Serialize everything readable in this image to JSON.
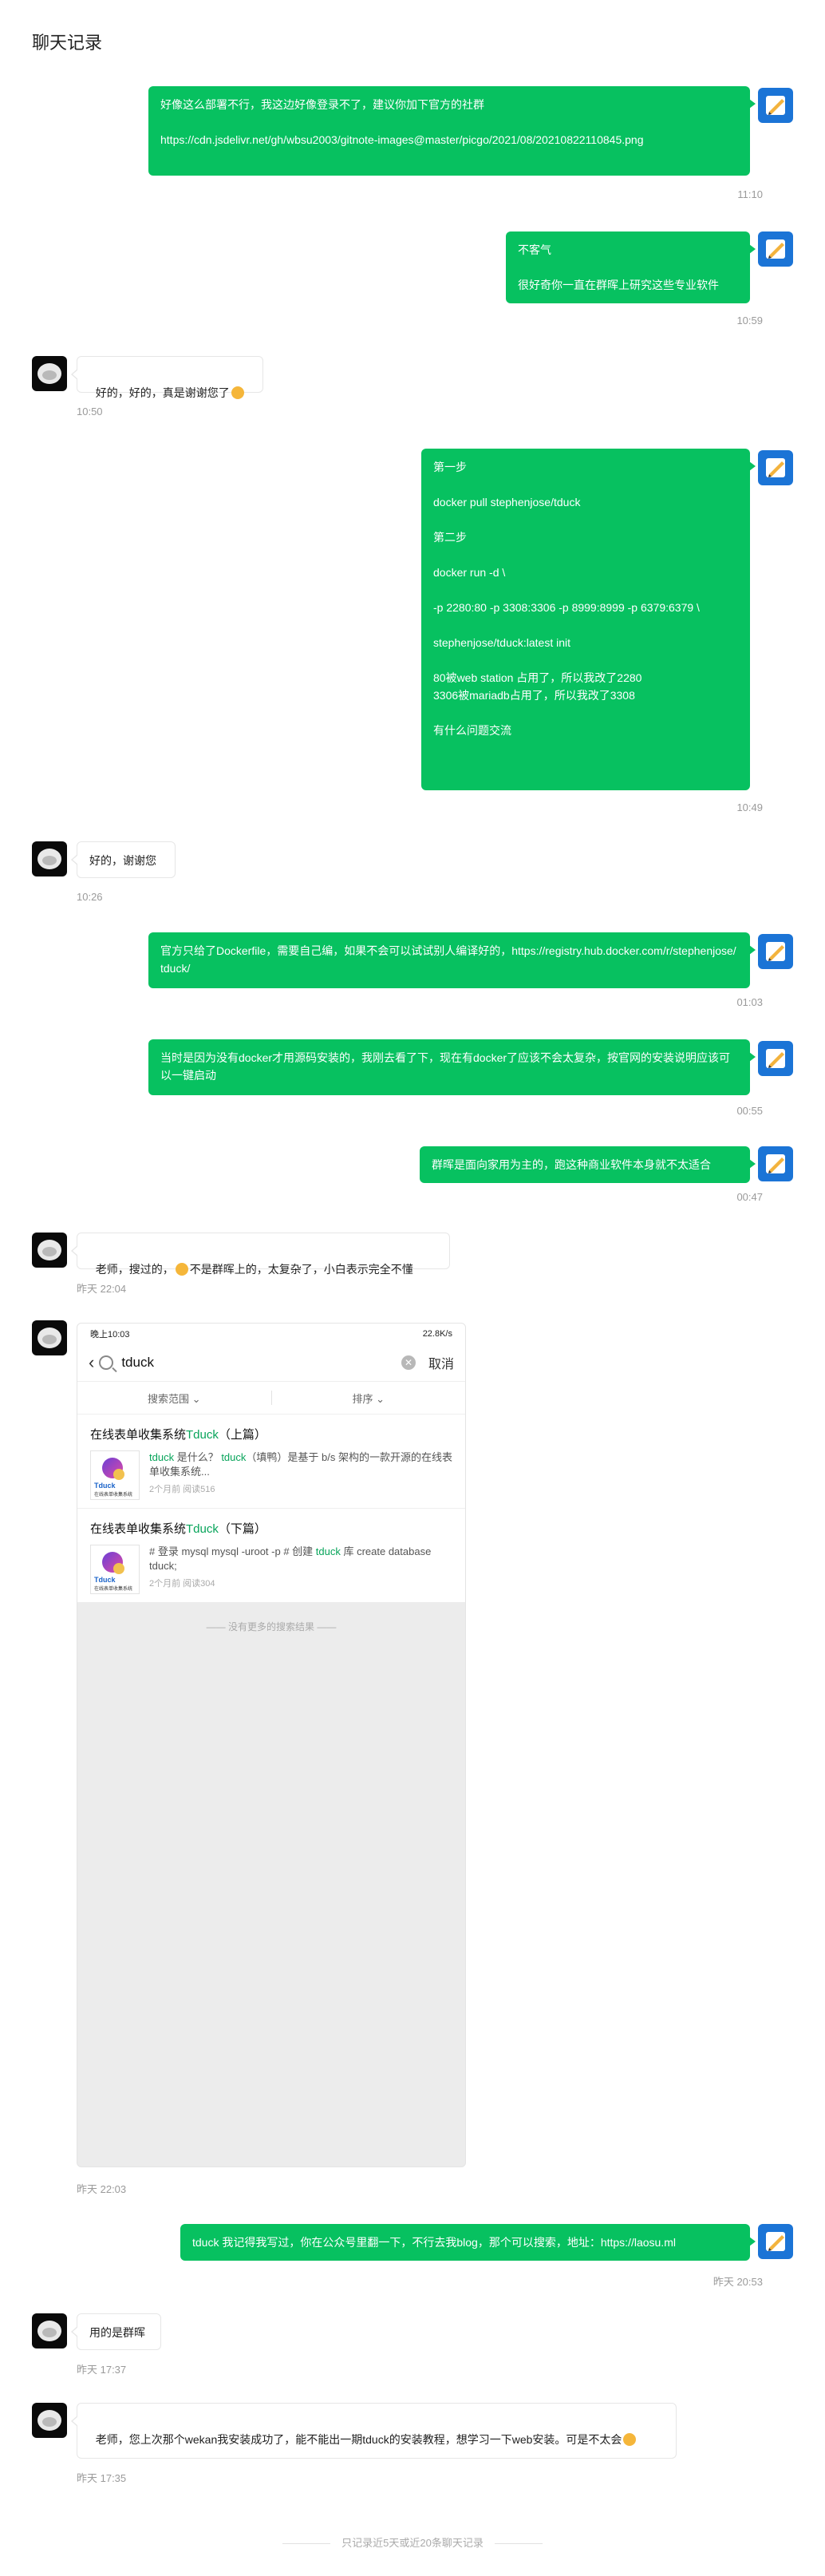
{
  "page": {
    "title": "聊天记录"
  },
  "messages": [
    {
      "side": "right",
      "text": "好像这么部署不行，我这边好像登录不了，建议你加下官方的社群\n\nhttps://cdn.jsdelivr.net/gh/wbsu2003/gitnote-images@master/picgo/2021/08/20210822110845.png",
      "time": "11:10"
    },
    {
      "side": "right",
      "text": "不客气\n\n很好奇你一直在群晖上研究这些专业软件",
      "time": "10:59"
    },
    {
      "side": "left",
      "text": "好的，好的，真是谢谢您了",
      "time": "10:50"
    },
    {
      "side": "right",
      "text": "第一步\n\ndocker pull stephenjose/tduck\n\n第二步\n\ndocker run -d \\\n\n-p 2280:80 -p 3308:3306 -p 8999:8999 -p 6379:6379 \\\n\nstephenjose/tduck:latest init\n\n80被web station 占用了，所以我改了2280\n3306被mariadb占用了，所以我改了3308\n\n有什么问题交流",
      "time": "10:49"
    },
    {
      "side": "left",
      "text": "好的，谢谢您",
      "time": "10:26"
    },
    {
      "side": "right",
      "text": "官方只给了Dockerfile，需要自己编，如果不会可以试试别人编译好的，https://registry.hub.docker.com/r/stephenjose/tduck/",
      "time": "01:03"
    },
    {
      "side": "right",
      "text": "当时是因为没有docker才用源码安装的，我刚去看了下，现在有docker了应该不会太复杂，按官网的安装说明应该可以一键启动",
      "time": "00:55"
    },
    {
      "side": "right",
      "text": "群晖是面向家用为主的，跑这种商业软件本身就不太适合",
      "time": "00:47"
    },
    {
      "side": "left",
      "text_a": "老师，搜过的，",
      "text_b": "不是群晖上的，太复杂了，小白表示完全不懂",
      "time": "昨天 22:04"
    },
    {
      "side": "left",
      "type": "image",
      "time": "昨天 22:03"
    },
    {
      "side": "right",
      "text": "tduck 我记得我写过，你在公众号里翻一下，不行去我blog，那个可以搜索，地址：https://laosu.ml",
      "time": "昨天 20:53"
    },
    {
      "side": "left",
      "text": "用的是群晖",
      "time": "昨天 17:37"
    },
    {
      "side": "left",
      "text_a": "老师，您上次那个wekan我安装成功了，能不能出一期tduck的安装教程，想学习一下web安装。可是不太会",
      "time": "昨天 17:35"
    }
  ],
  "screenshot": {
    "status_left": "晚上10:03",
    "status_right": "22.8K/s",
    "query": "tduck",
    "cancel": "取消",
    "filter1": "搜索范围",
    "filter2": "排序",
    "results": [
      {
        "title_a": "在线表单收集系统",
        "title_hl": "Tduck",
        "title_b": "（上篇）",
        "snippet_hl": "tduck",
        "snippet_a": " 是什么？ ",
        "snippet_hl2": "tduck",
        "snippet_b": "（填鸭）是基于 b/s 架构的一款开源的在线表单收集系统...",
        "meta": "2个月前   阅读516",
        "thumb_brand": "Tduck",
        "thumb_caption": "在线表单收集系统"
      },
      {
        "title_a": "在线表单收集系统",
        "title_hl": "Tduck",
        "title_b": "（下篇）",
        "snippet_hl": "",
        "snippet_a": "# 登录 mysql mysql -uroot -p # 创建 ",
        "snippet_hl2": "tduck",
        "snippet_b": " 库 create database tduck;",
        "meta": "2个月前   阅读304",
        "thumb_brand": "Tduck",
        "thumb_caption": "在线表单收集系统"
      }
    ],
    "no_more": "—— 没有更多的搜索结果 ——"
  },
  "footer": {
    "note": "只记录近5天或近20条聊天记录"
  },
  "colors": {
    "bubble_green": "#07c160",
    "avatar_right": "#1b74d6"
  }
}
